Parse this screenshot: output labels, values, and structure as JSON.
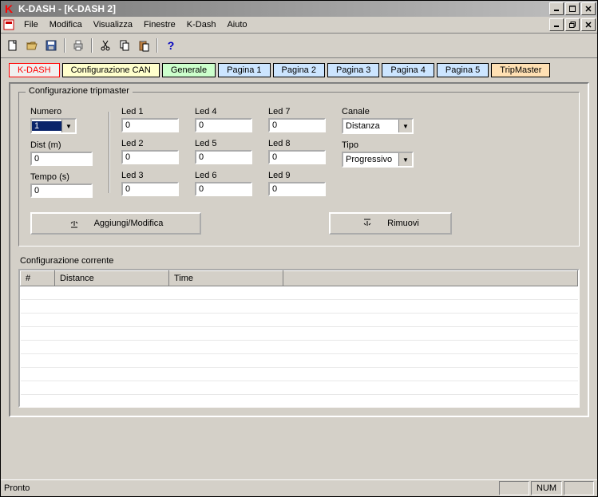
{
  "window": {
    "title": "K-DASH - [K-DASH 2]"
  },
  "menu": {
    "file": "File",
    "modifica": "Modifica",
    "visualizza": "Visualizza",
    "finestre": "Finestre",
    "kdash": "K-Dash",
    "aiuto": "Aiuto"
  },
  "tabs": {
    "kdash": "K-DASH",
    "can": "Configurazione CAN",
    "generale": "Generale",
    "p1": "Pagina 1",
    "p2": "Pagina 2",
    "p3": "Pagina 3",
    "p4": "Pagina 4",
    "p5": "Pagina 5",
    "tripmaster": "TripMaster"
  },
  "group": {
    "legend": "Configurazione tripmaster",
    "numero_label": "Numero",
    "numero_value": "1",
    "dist_label": "Dist (m)",
    "dist_value": "0",
    "tempo_label": "Tempo (s)",
    "tempo_value": "0",
    "led1_label": "Led 1",
    "led1_value": "0",
    "led2_label": "Led 2",
    "led2_value": "0",
    "led3_label": "Led 3",
    "led3_value": "0",
    "led4_label": "Led 4",
    "led4_value": "0",
    "led5_label": "Led 5",
    "led5_value": "0",
    "led6_label": "Led 6",
    "led6_value": "0",
    "led7_label": "Led 7",
    "led7_value": "0",
    "led8_label": "Led 8",
    "led8_value": "0",
    "led9_label": "Led 9",
    "led9_value": "0",
    "canale_label": "Canale",
    "canale_value": "Distanza",
    "tipo_label": "Tipo",
    "tipo_value": "Progressivo",
    "aggiungi": "Aggiungi/Modifica",
    "rimuovi": "Rimuovi"
  },
  "table": {
    "heading": "Configurazione corrente",
    "col_index": "#",
    "col_distance": "Distance",
    "col_time": "Time"
  },
  "status": {
    "text": "Pronto",
    "num": "NUM"
  }
}
